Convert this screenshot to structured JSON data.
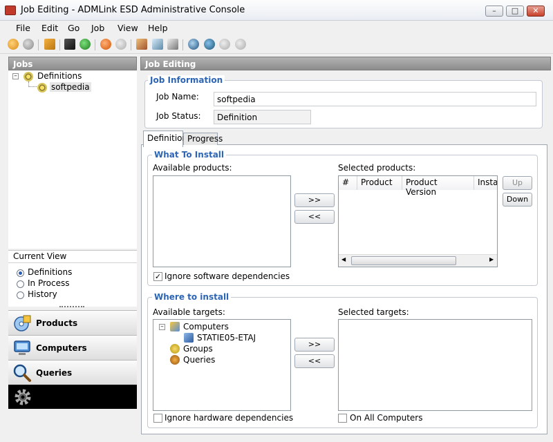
{
  "window": {
    "title": "Job Editing - ADMLink ESD Administrative Console"
  },
  "menu": [
    "File",
    "Edit",
    "Go",
    "Job",
    "View",
    "Help"
  ],
  "left": {
    "jobs_header": "Jobs",
    "tree": {
      "root": "Definitions",
      "child": "softpedia"
    },
    "current_view": {
      "label": "Current View",
      "options": [
        "Definitions",
        "In Process",
        "History"
      ],
      "selected": "Definitions"
    },
    "nav": [
      "Products",
      "Computers",
      "Queries"
    ]
  },
  "right": {
    "header": "Job Editing",
    "job_info": {
      "title": "Job Information",
      "name_label": "Job Name:",
      "name_value": "softpedia",
      "status_label": "Job Status:",
      "status_value": "Definition"
    },
    "tabs": [
      "Definition",
      "Progress"
    ],
    "what": {
      "title": "What To Install",
      "available_label": "Available products:",
      "selected_label": "Selected products:",
      "columns": [
        "#",
        "Product",
        "Product Version",
        "Install"
      ],
      "add": ">>",
      "remove": "<<",
      "up": "Up",
      "down": "Down",
      "ignore_label": "Ignore software dependencies",
      "ignore_checked": true
    },
    "where": {
      "title": "Where to install",
      "available_label": "Available targets:",
      "selected_label": "Selected targets:",
      "tree": {
        "computers": "Computers",
        "computer": "STATIE05-ETAJ",
        "groups": "Groups",
        "queries": "Queries"
      },
      "add": ">>",
      "remove": "<<",
      "ignore_label": "Ignore hardware dependencies",
      "all_label": "On All Computers"
    }
  }
}
